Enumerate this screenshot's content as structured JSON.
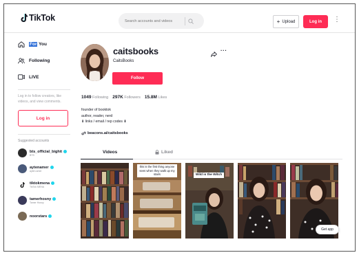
{
  "header": {
    "logo_text": "TikTok",
    "search_placeholder": "Search accounts and videos",
    "upload_label": "Upload",
    "login_label": "Log in"
  },
  "sidebar": {
    "nav": [
      {
        "label": "For You",
        "icon": "home-icon"
      },
      {
        "label": "Following",
        "icon": "following-icon"
      },
      {
        "label": "LIVE",
        "icon": "live-icon"
      }
    ],
    "nav_for_highlight": "For",
    "nav_for_rest": " You",
    "login_hint": "Log in to follow creators, like videos, and view comments.",
    "login_label": "Log in",
    "suggested_title": "Suggested accounts",
    "accounts": [
      {
        "name": "bts_official_bighit",
        "sub": "BTS",
        "color": "#2b2b2b"
      },
      {
        "name": "aytenamer",
        "sub": "ayten amer",
        "color": "#4a5a7a"
      },
      {
        "name": "tiktokmena",
        "sub": "TikTok MENA",
        "color": "#111111"
      },
      {
        "name": "tamerhosny",
        "sub": "Tamer Hosny",
        "color": "#3a3a5a"
      },
      {
        "name": "noorstars",
        "sub": "",
        "color": "#7a6a55"
      }
    ]
  },
  "profile": {
    "username": "caitsbooks",
    "display_name": "CaitsBooks",
    "follow_label": "Follow",
    "stats": {
      "following_count": "1049",
      "following_label": "Following",
      "followers_count": "297K",
      "followers_label": "Followers",
      "likes_count": "15.8M",
      "likes_label": "Likes"
    },
    "bio": [
      "founder of booktok",
      "author, reader, nerd",
      "⬇ links / email / rep codes ⬇"
    ],
    "link": "beacons.ai/caitsbooks"
  },
  "tabs": {
    "videos": "Videos",
    "liked": "Liked"
  },
  "videos": [
    {
      "caption": ""
    },
    {
      "caption": "this is the first thing anyone sees when they walk up my stairs"
    },
    {
      "caption": "Wild is the Witch"
    },
    {
      "caption": ""
    },
    {
      "caption": ""
    }
  ],
  "get_app_label": "Get app",
  "colors": {
    "brand": "#fe2c55",
    "verified": "#20d5ec",
    "text": "#161823",
    "muted": "#8a8b91"
  }
}
